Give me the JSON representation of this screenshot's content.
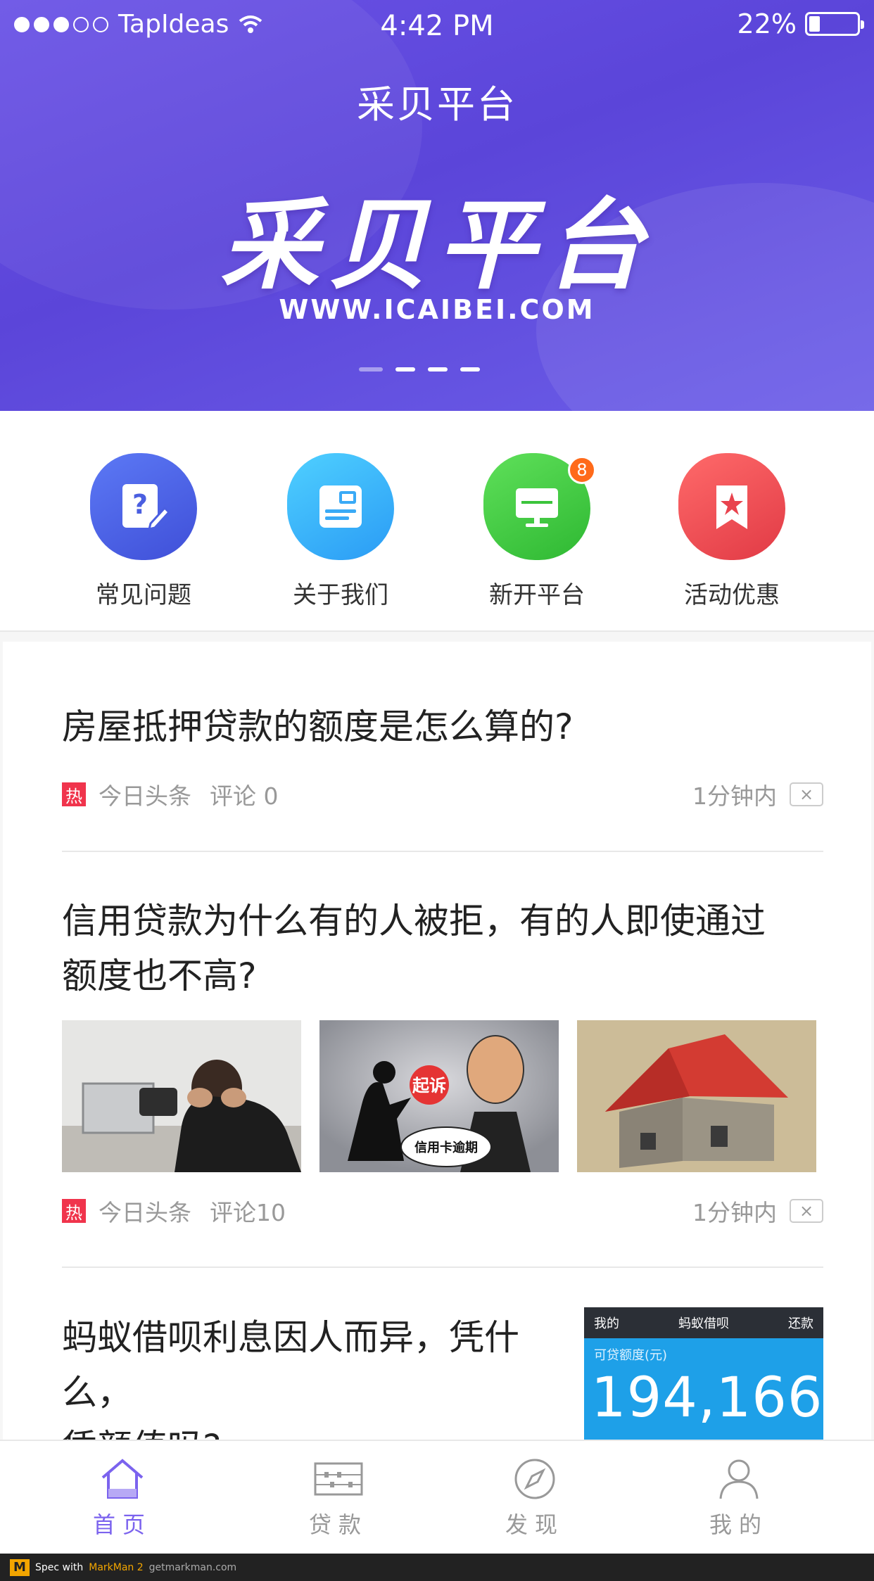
{
  "status_bar": {
    "carrier": "TapIdeas",
    "time": "4:42 PM",
    "battery": "22%",
    "battery_level": 0.22
  },
  "header": {
    "nav_title": "采贝平台",
    "brand": "采贝平台",
    "url": "WWW.ICAIBEI.COM",
    "page_count": 4,
    "active_page": 1
  },
  "quick_menu": [
    {
      "label": "常见问题",
      "icon": "question-doc-icon",
      "color_from": "#5c79f5",
      "color_to": "#3f4fd8"
    },
    {
      "label": "关于我们",
      "icon": "info-card-icon",
      "color_from": "#4fd0ff",
      "color_to": "#2a9bf5"
    },
    {
      "label": "新开平台",
      "icon": "monitor-icon",
      "color_from": "#5fe05a",
      "color_to": "#2eb832",
      "badge": "8"
    },
    {
      "label": "活动优惠",
      "icon": "star-bookmark-icon",
      "color_from": "#ff6a6a",
      "color_to": "#e13a45"
    }
  ],
  "articles": [
    {
      "title": "房屋抵押贷款的额度是怎么算的?",
      "hot_tag": "热",
      "source": "今日头条",
      "comments": "评论 0",
      "time": "1分钟内",
      "dismiss": "×"
    },
    {
      "title_line1": "信用贷款为什么有的人被拒，有的人即使通过",
      "title_line2": "额度也不高?",
      "hot_tag": "热",
      "source": "今日头条",
      "comments": "评论10",
      "time": "1分钟内",
      "dismiss": "×",
      "images": [
        "stressed-man-at-laptop-photo",
        "credit-card-lawsuit-cartoon",
        "house-on-money-photo"
      ],
      "image_text": {
        "sue": "起诉",
        "overdue": "信用卡逾期"
      }
    },
    {
      "title_line1": "蚂蚁借呗利息因人而异，凭什么，",
      "title_line2": "凭颜值吗?",
      "screenshot": {
        "back": "我的",
        "title": "蚂蚁借呗",
        "action": "还款",
        "label": "可贷额度(元)",
        "amount": "194,166"
      }
    }
  ],
  "tab_bar": [
    {
      "label": "首页",
      "icon": "home-icon",
      "active": true
    },
    {
      "label": "贷款",
      "icon": "abacus-icon",
      "active": false
    },
    {
      "label": "发现",
      "icon": "compass-icon",
      "active": false
    },
    {
      "label": "我的",
      "icon": "user-icon",
      "active": false
    }
  ],
  "footer": {
    "text": "Spec with",
    "brand": "MarkMan 2",
    "site": "getmarkman.com"
  },
  "colors": {
    "accent": "#7b63ee",
    "hot": "#f0344c",
    "text": "#333333",
    "divider": "#e8e8e8",
    "background": "#f6f6f6"
  }
}
